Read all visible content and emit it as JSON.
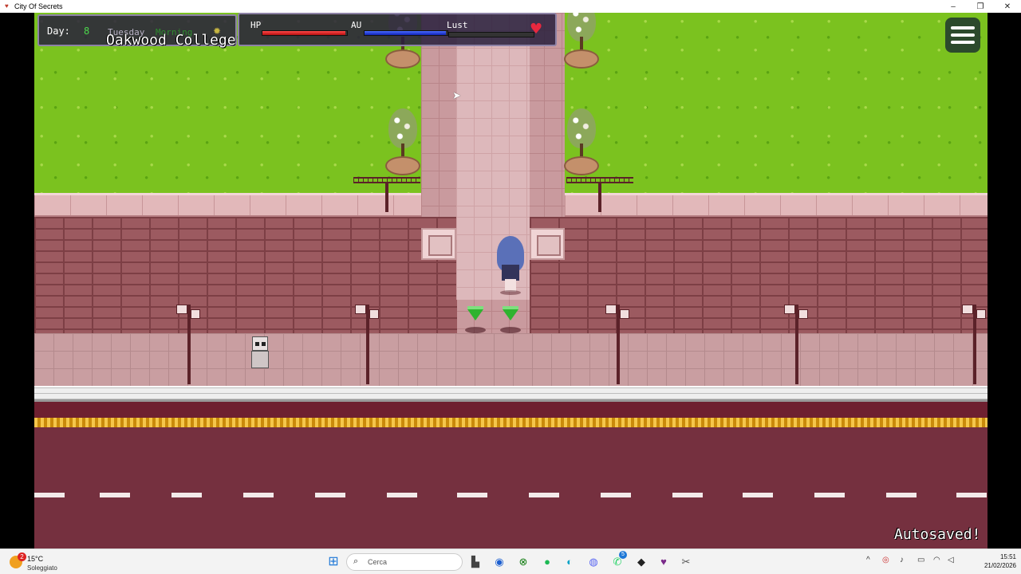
{
  "window": {
    "title": "City Of Secrets",
    "controls": [
      "–",
      "❐",
      "✕"
    ]
  },
  "hud": {
    "day_label": "Day:",
    "day_value": "8",
    "weekday": "Tuesday",
    "time_of_day": "Morning",
    "location": "Oakwood College",
    "stats": [
      {
        "label": "HP",
        "fraction": 0.98,
        "color": "#e02020"
      },
      {
        "label": "AU",
        "fraction": 0.98,
        "color": "#2040e0"
      },
      {
        "label": "Lust",
        "fraction": 0.0,
        "color": "#e0307a"
      }
    ]
  },
  "game_text": {
    "autosave": "Autosaved!"
  },
  "taskbar": {
    "weather_badge": "2",
    "weather_temp": "15°C",
    "weather_condition": "Soleggiato",
    "search_placeholder": "Cerca",
    "time": "15:51",
    "date": "21/02/2026",
    "pinned_icons": [
      "files-icon",
      "browser-icon",
      "xbox-icon",
      "spotify-icon",
      "edge-icon",
      "discord-icon",
      "whatsapp-icon",
      "game-icon",
      "city-of-secrets-icon",
      "snipping-tool-icon"
    ],
    "whatsapp_badge": "5"
  }
}
